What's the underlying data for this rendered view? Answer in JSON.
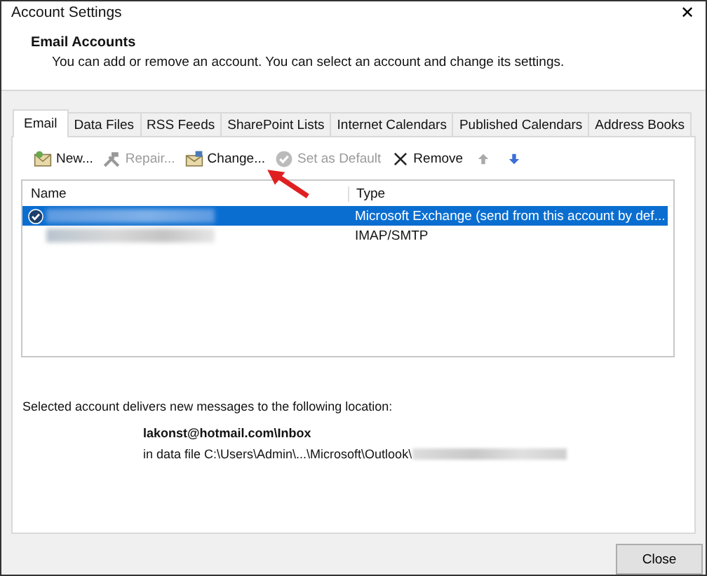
{
  "window": {
    "title": "Account Settings",
    "close_glyph": "✕"
  },
  "header": {
    "title": "Email Accounts",
    "description": "You can add or remove an account. You can select an account and change its settings."
  },
  "tabs": [
    {
      "label": "Email",
      "selected": true
    },
    {
      "label": "Data Files",
      "selected": false
    },
    {
      "label": "RSS Feeds",
      "selected": false
    },
    {
      "label": "SharePoint Lists",
      "selected": false
    },
    {
      "label": "Internet Calendars",
      "selected": false
    },
    {
      "label": "Published Calendars",
      "selected": false
    },
    {
      "label": "Address Books",
      "selected": false
    }
  ],
  "toolbar": [
    {
      "kind": "new",
      "label": "New...",
      "disabled": false
    },
    {
      "kind": "repair",
      "label": "Repair...",
      "disabled": true
    },
    {
      "kind": "change",
      "label": "Change...",
      "disabled": false
    },
    {
      "kind": "default",
      "label": "Set as Default",
      "disabled": true
    },
    {
      "kind": "remove",
      "label": "Remove",
      "disabled": false
    },
    {
      "kind": "up",
      "disabled": true
    },
    {
      "kind": "down",
      "disabled": false
    }
  ],
  "table": {
    "columns": [
      "Name",
      "Type"
    ],
    "rows": [
      {
        "type": "Microsoft Exchange (send from this account by def...",
        "selected": true,
        "default": true
      },
      {
        "type": "IMAP/SMTP",
        "selected": false,
        "default": false
      }
    ]
  },
  "delivery": {
    "intro": "Selected account delivers new messages to the following location:",
    "folder": "lakonst@hotmail.com\\Inbox",
    "data_file": "in data file C:\\Users\\Admin\\...\\Microsoft\\Outlook\\"
  },
  "buttons": [
    {
      "label": "Close"
    }
  ]
}
